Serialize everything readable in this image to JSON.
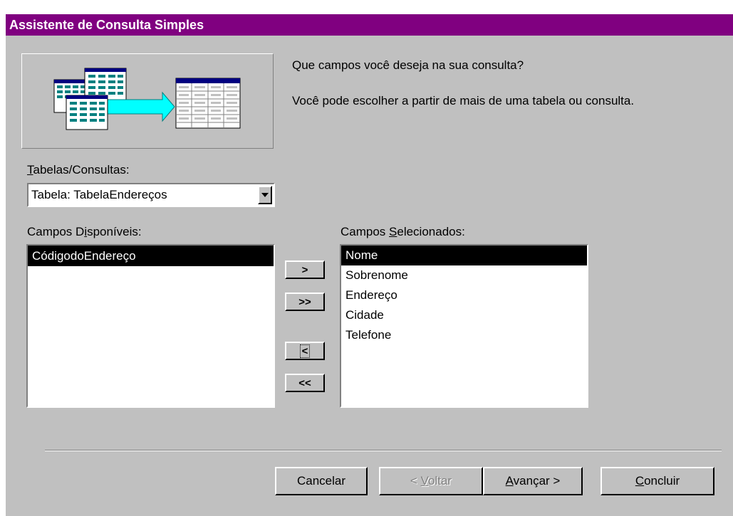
{
  "window": {
    "title": "Assistente de Consulta Simples"
  },
  "instructions": {
    "question": "Que campos você deseja na sua consulta?",
    "hint": "Você pode escolher a partir de mais de uma tabela ou consulta."
  },
  "tables_label": {
    "mnemonic": "T",
    "rest": "abelas/Consultas:"
  },
  "tables_combo": {
    "value": "Tabela: TabelaEndereços"
  },
  "available": {
    "label_pre": "Campos D",
    "label_mnemonic": "i",
    "label_post": "sponíveis:",
    "items": [
      "CódigodoEndereço"
    ]
  },
  "selected": {
    "label_pre": "Campos ",
    "label_mnemonic": "S",
    "label_post": "elecionados:",
    "items": [
      "Nome",
      "Sobrenome",
      "Endereço",
      "Cidade",
      "Telefone"
    ]
  },
  "move_buttons": {
    "add_one": ">",
    "add_all": ">>",
    "remove_one": "<",
    "remove_all": "<<"
  },
  "footer": {
    "cancel": "Cancelar",
    "back_prefix": "< ",
    "back_mnemonic": "V",
    "back_rest": "oltar",
    "next_mnemonic": "A",
    "next_rest": "vançar >",
    "finish_mnemonic": "C",
    "finish_rest": "oncluir"
  },
  "colors": {
    "titlebar": "#800080",
    "dialog": "#c0c0c0",
    "illustration_cyan": "#00ffff",
    "illustration_navy": "#000080",
    "illustration_teal": "#008080"
  }
}
